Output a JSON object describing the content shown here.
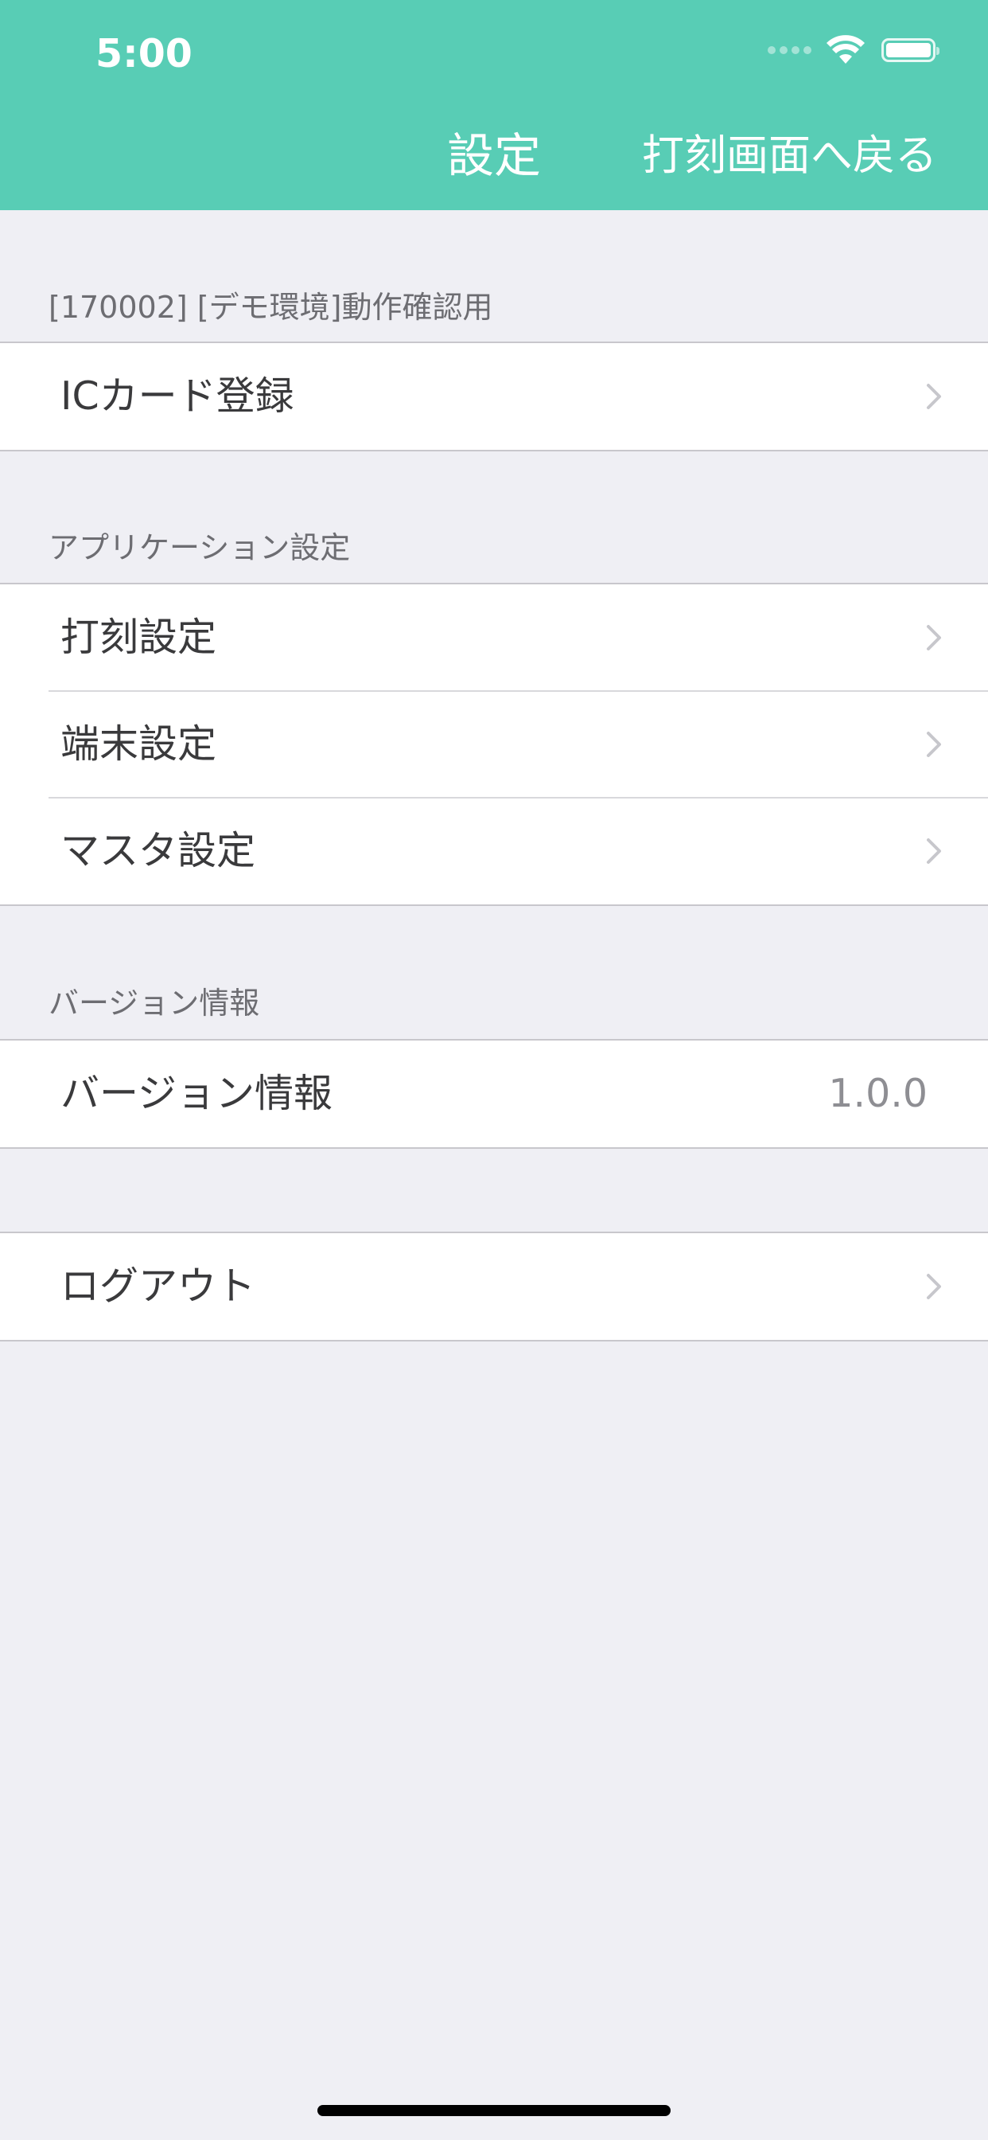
{
  "status_bar": {
    "time": "5:00"
  },
  "nav": {
    "title": "設定",
    "back_label": "打刻画面へ戻る"
  },
  "sections": [
    {
      "header": "[170002] [デモ環境]動作確認用",
      "rows": [
        {
          "label": "ICカード登録",
          "icon": "chevron-right-icon"
        }
      ]
    },
    {
      "header": "アプリケーション設定",
      "rows": [
        {
          "label": "打刻設定",
          "icon": "chevron-right-icon"
        },
        {
          "label": "端末設定",
          "icon": "chevron-right-icon"
        },
        {
          "label": "マスタ設定",
          "icon": "chevron-right-icon"
        }
      ]
    },
    {
      "header": "バージョン情報",
      "rows": [
        {
          "label": "バージョン情報",
          "value": "1.0.0"
        }
      ]
    },
    {
      "header": "",
      "rows": [
        {
          "label": "ログアウト",
          "icon": "chevron-right-icon"
        }
      ]
    }
  ],
  "colors": {
    "header_bg": "#58cdb5",
    "page_bg": "#efeff4",
    "row_text": "#3a3a3c",
    "section_text": "#6d6d72",
    "chevron": "#c7c7cc"
  }
}
